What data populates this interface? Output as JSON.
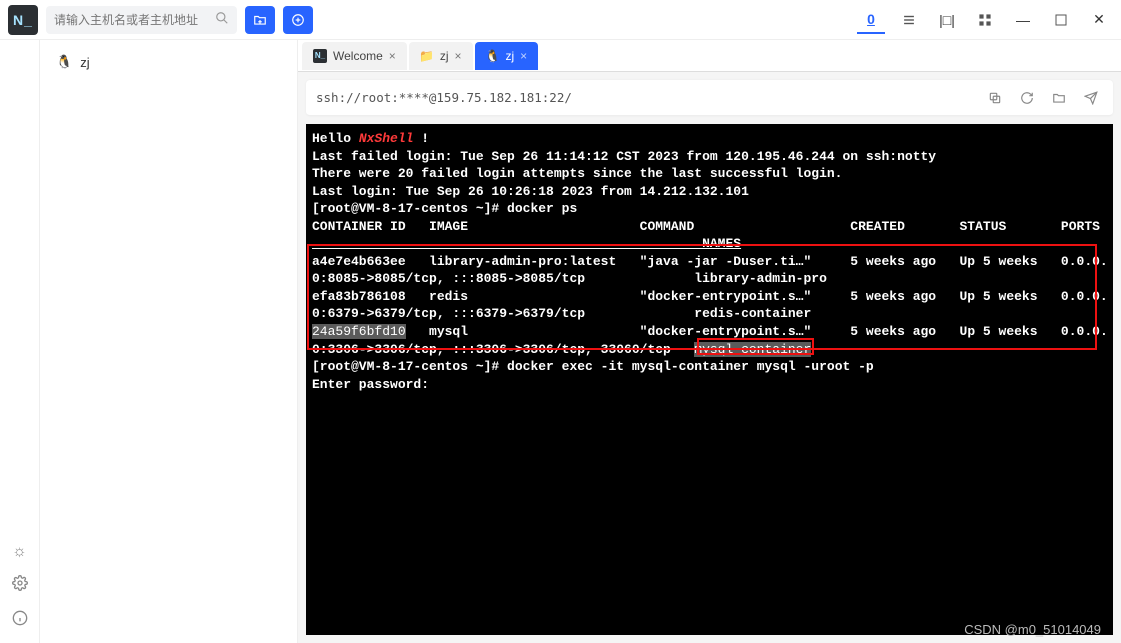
{
  "logo_text": "N_",
  "search": {
    "placeholder": "请输入主机名或者主机地址"
  },
  "topbar_icons": {
    "folder_add": "add-folder-icon",
    "plus": "plus-icon",
    "underline": "u",
    "three_bars": "bars",
    "split": "split",
    "grid": "grid",
    "minimize": "—",
    "maximize": "▢",
    "close": "✕"
  },
  "tree": {
    "items": [
      {
        "label": "zj",
        "icon": "penguin-icon"
      }
    ]
  },
  "tabs": [
    {
      "label": "Welcome",
      "icon": "logo-icon",
      "active": false
    },
    {
      "label": "zj",
      "icon": "folder-icon",
      "active": false
    },
    {
      "label": "zj",
      "icon": "penguin-icon",
      "active": true
    }
  ],
  "tab_close": "×",
  "address": {
    "text": "ssh://root:****@159.75.182.181:22/",
    "icons": [
      "copy-icon",
      "refresh-icon",
      "folder-open-icon",
      "send-icon"
    ]
  },
  "terminal": {
    "hello_prefix": "Hello ",
    "hello_brand": "NxShell",
    "hello_suffix": " !",
    "line_last_failed": "Last failed login: Tue Sep 26 11:14:12 CST 2023 from 120.195.46.244 on ssh:notty",
    "line_failed_count": "There were 20 failed login attempts since the last successful login.",
    "line_last_login": "Last login: Tue Sep 26 10:26:18 2023 from 14.212.132.101",
    "prompt1_user": "[root@VM-8-17-centos ~]# ",
    "prompt1_cmd": "docker ps",
    "header_line": "CONTAINER ID   IMAGE                      COMMAND                    CREATED       STATUS       PORTS",
    "header_names": "                                                  NAMES",
    "rows": [
      {
        "l1": "a4e7e4b663ee   library-admin-pro:latest   \"java -jar -Duser.ti…\"     5 weeks ago   Up 5 weeks   0.0.0.",
        "l2": "0:8085->8085/tcp, :::8085->8085/tcp              library-admin-pro"
      },
      {
        "l1": "efa83b786108   redis                      \"docker-entrypoint.s…\"     5 weeks ago   Up 5 weeks   0.0.0.",
        "l2": "0:6379->6379/tcp, :::6379->6379/tcp              redis-container"
      }
    ],
    "row3_a": "24a59f6bfd10",
    "row3_b": "   mysql                      \"docker-entrypoint.s…\"     5 weeks ago   Up 5 weeks   0.0.0.",
    "row3_c": "0:3306->3306/tcp, :::3306->3306/tcp, 33060/tcp   ",
    "row3_d": "mysql-container",
    "prompt2_user": "[root@VM-8-17-centos ~]# ",
    "prompt2_cmd": "docker exec -it mysql-container mysql -uroot -p",
    "prompt3": "Enter password:"
  },
  "watermark": "CSDN @m0_51014049"
}
